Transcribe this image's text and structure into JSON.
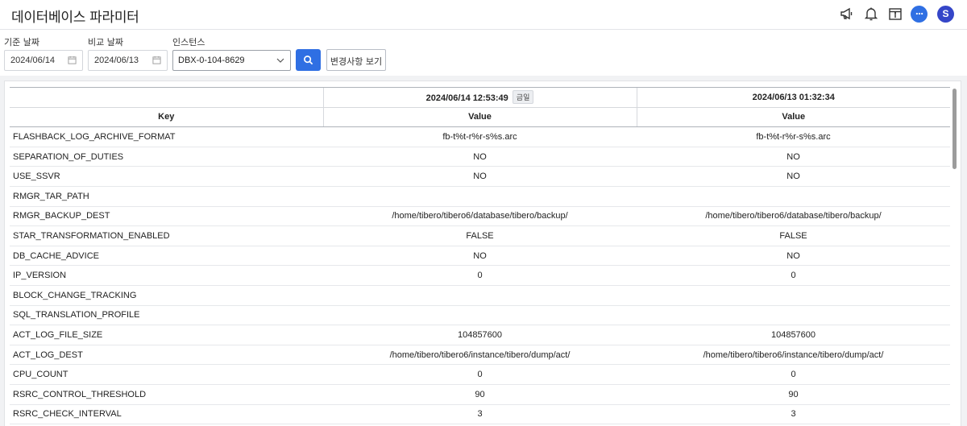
{
  "header": {
    "title": "데이터베이스 파라미터",
    "icons": [
      "megaphone-icon",
      "bell-icon",
      "calendar-info-icon",
      "chat-icon"
    ],
    "avatar_initial": "S"
  },
  "filters": {
    "base_date_label": "기준 날짜",
    "base_date_value": "2024/06/14",
    "compare_date_label": "비교 날짜",
    "compare_date_value": "2024/06/13",
    "instance_label": "인스턴스",
    "instance_value": "DBX-0-104-8629",
    "change_button_label": "변경사항 보기"
  },
  "table": {
    "col1_datetime": "2024/06/14 12:53:49",
    "col1_badge": "금일",
    "col2_datetime": "2024/06/13 01:32:34",
    "key_header": "Key",
    "value_header": "Value",
    "rows": [
      {
        "key": "FLASHBACK_LOG_ARCHIVE_FORMAT",
        "v1": "fb-t%t-r%r-s%s.arc",
        "v2": "fb-t%t-r%r-s%s.arc"
      },
      {
        "key": "SEPARATION_OF_DUTIES",
        "v1": "NO",
        "v2": "NO"
      },
      {
        "key": "USE_SSVR",
        "v1": "NO",
        "v2": "NO"
      },
      {
        "key": "RMGR_TAR_PATH",
        "v1": "",
        "v2": ""
      },
      {
        "key": "RMGR_BACKUP_DEST",
        "v1": "/home/tibero/tibero6/database/tibero/backup/",
        "v2": "/home/tibero/tibero6/database/tibero/backup/"
      },
      {
        "key": "STAR_TRANSFORMATION_ENABLED",
        "v1": "FALSE",
        "v2": "FALSE"
      },
      {
        "key": "DB_CACHE_ADVICE",
        "v1": "NO",
        "v2": "NO"
      },
      {
        "key": "IP_VERSION",
        "v1": "0",
        "v2": "0"
      },
      {
        "key": "BLOCK_CHANGE_TRACKING",
        "v1": "",
        "v2": ""
      },
      {
        "key": "SQL_TRANSLATION_PROFILE",
        "v1": "",
        "v2": ""
      },
      {
        "key": "ACT_LOG_FILE_SIZE",
        "v1": "104857600",
        "v2": "104857600"
      },
      {
        "key": "ACT_LOG_DEST",
        "v1": "/home/tibero/tibero6/instance/tibero/dump/act/",
        "v2": "/home/tibero/tibero6/instance/tibero/dump/act/"
      },
      {
        "key": "CPU_COUNT",
        "v1": "0",
        "v2": "0"
      },
      {
        "key": "RSRC_CONTROL_THRESHOLD",
        "v1": "90",
        "v2": "90"
      },
      {
        "key": "RSRC_CHECK_INTERVAL",
        "v1": "3",
        "v2": "3"
      },
      {
        "key": "",
        "v1": "",
        "v2": ""
      }
    ]
  },
  "colors": {
    "accent": "#2f6fe3",
    "avatar": "#3546c8"
  }
}
